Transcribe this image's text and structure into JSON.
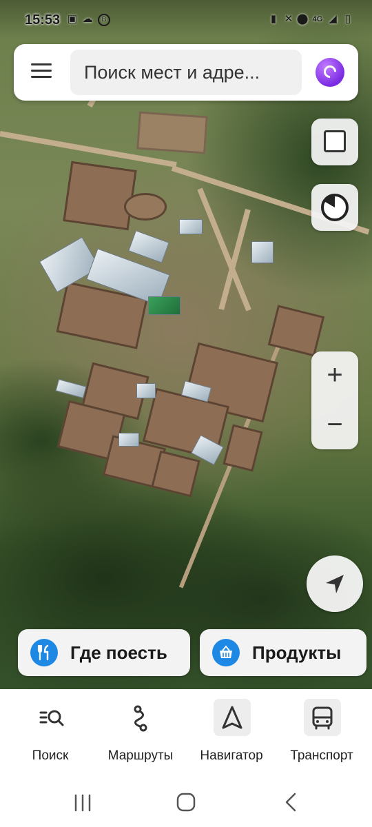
{
  "status_bar": {
    "time": "15:53",
    "left_icons": [
      "image-icon",
      "cloud-icon",
      "b-badge-icon"
    ],
    "right_icons": [
      "battery-saver-icon",
      "vibrate-icon",
      "location-icon",
      "4g-signal-icon",
      "wifi-signal-icon",
      "battery-icon"
    ]
  },
  "search": {
    "placeholder": "Поиск мест и адре..."
  },
  "quick_chips": [
    {
      "label": "Где поесть",
      "icon": "fork-knife-icon"
    },
    {
      "label": "Продукты",
      "icon": "basket-icon"
    }
  ],
  "tabs": [
    {
      "label": "Поиск",
      "icon": "search-list-icon"
    },
    {
      "label": "Маршруты",
      "icon": "route-icon"
    },
    {
      "label": "Навигатор",
      "icon": "navigator-arrow-icon"
    },
    {
      "label": "Транспорт",
      "icon": "bus-icon"
    }
  ],
  "zoom": {
    "in": "+",
    "out": "−"
  },
  "colors": {
    "chip_icon_bg": "#1e88e5",
    "alice_purple": "#7a2be2"
  }
}
